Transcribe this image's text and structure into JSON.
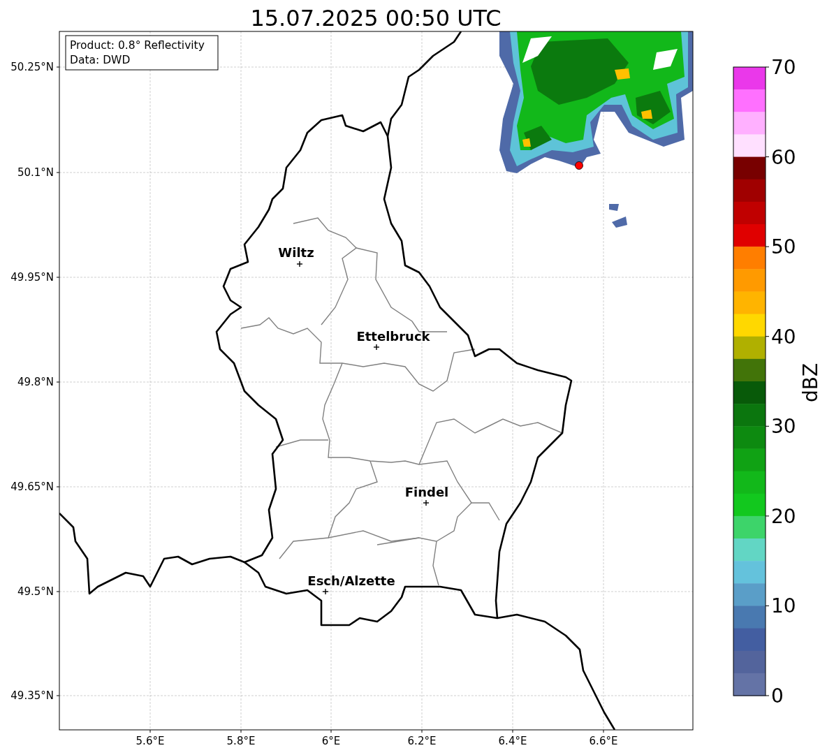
{
  "title": "15.07.2025 00:50 UTC",
  "info_box": [
    "Product: 0.8° Reflectivity",
    "Data: DWD"
  ],
  "map": {
    "y_ticks": [
      "50.25°N",
      "50.1°N",
      "49.95°N",
      "49.8°N",
      "49.65°N",
      "49.5°N",
      "49.35°N"
    ],
    "x_ticks": [
      "5.6°E",
      "5.8°E",
      "6°E",
      "6.2°E",
      "6.4°E",
      "6.6°E"
    ],
    "cities": [
      {
        "name": "Wiltz"
      },
      {
        "name": "Ettelbruck"
      },
      {
        "name": "Findel"
      },
      {
        "name": "Esch/Alzette"
      }
    ],
    "radar_site": {
      "color": "#ff0000"
    }
  },
  "colorbar": {
    "label": "dBZ",
    "ticks": [
      "70",
      "60",
      "50",
      "40",
      "30",
      "20",
      "10",
      "0"
    ],
    "bands": [
      {
        "color": "#ea38ea"
      },
      {
        "color": "#ff70ff"
      },
      {
        "color": "#ffb0ff"
      },
      {
        "color": "#ffe0ff"
      },
      {
        "color": "#780000"
      },
      {
        "color": "#a00000"
      },
      {
        "color": "#c00000"
      },
      {
        "color": "#e00000"
      },
      {
        "color": "#ff7e00"
      },
      {
        "color": "#ff9a00"
      },
      {
        "color": "#ffb400"
      },
      {
        "color": "#ffd800"
      },
      {
        "color": "#b0b000"
      },
      {
        "color": "#427409"
      },
      {
        "color": "#085a09"
      },
      {
        "color": "#0b760e"
      },
      {
        "color": "#0d8a10"
      },
      {
        "color": "#10a214"
      },
      {
        "color": "#12b81a"
      },
      {
        "color": "#12c81e"
      },
      {
        "color": "#3dd46a"
      },
      {
        "color": "#62d6c4"
      },
      {
        "color": "#64c2dc"
      },
      {
        "color": "#5a9ec8"
      },
      {
        "color": "#4979b0"
      },
      {
        "color": "#435ea1"
      },
      {
        "color": "#53649c"
      },
      {
        "color": "#6473a6"
      }
    ]
  }
}
